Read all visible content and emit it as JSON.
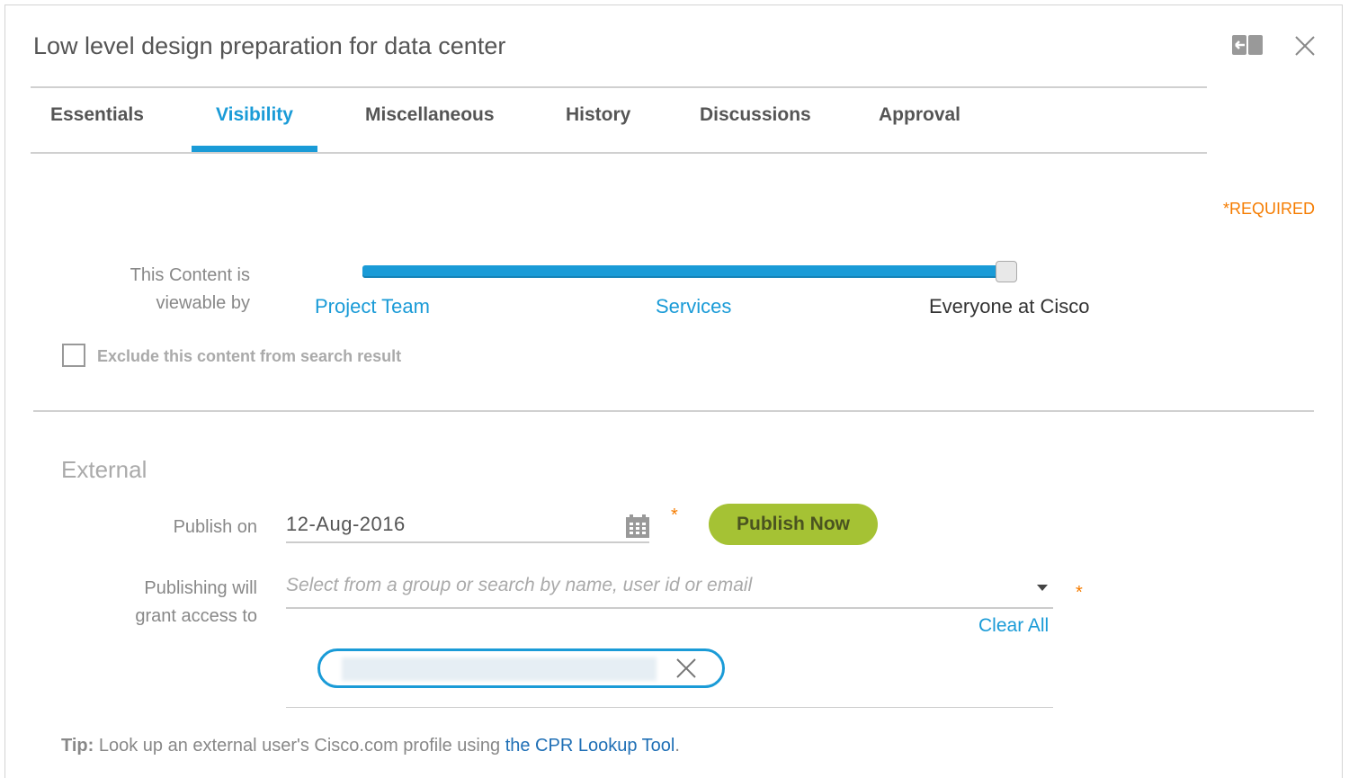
{
  "window": {
    "title": "Low level design preparation for data center",
    "icons": [
      "panel-collapse-icon",
      "close-icon"
    ]
  },
  "tabs": [
    {
      "label": "Essentials"
    },
    {
      "label": "Visibility",
      "active": true
    },
    {
      "label": "Miscellaneous"
    },
    {
      "label": "History"
    },
    {
      "label": "Discussions"
    },
    {
      "label": "Approval"
    }
  ],
  "required": "*REQUIRED",
  "visibility": {
    "label_line1": "This Content is",
    "label_line2": "viewable by",
    "levels": [
      "Project Team",
      "Services",
      "Everyone at Cisco"
    ],
    "selected": "Everyone at Cisco",
    "slider_percent": 100,
    "exclude_label": "Exclude this content from search result",
    "exclude_checked": false
  },
  "external": {
    "heading": "External",
    "publish_label": "Publish on",
    "publish_date": "12-Aug-2016",
    "required_mark": "*",
    "publish_now": "Publish Now",
    "access_label_line1": "Publishing will",
    "access_label_line2": "grant access to",
    "access_placeholder": "Select from a group or search by name, user id or email",
    "clear_all": "Clear All"
  },
  "tip": {
    "prefix": "Tip:",
    "text": " Look up an external user's Cisco.com profile using ",
    "link": "the CPR Lookup Tool",
    "suffix": "."
  },
  "colors": {
    "accent": "#1a9bd7",
    "button": "#a5c234",
    "required": "#f57c00",
    "link": "#1f6fb5"
  }
}
